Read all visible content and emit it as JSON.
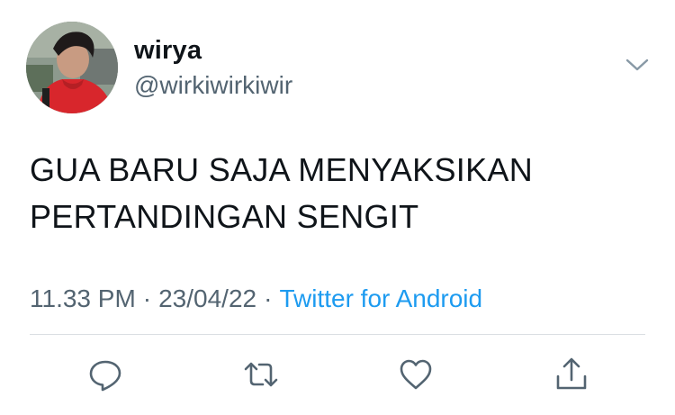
{
  "tweet": {
    "display_name": "wirya",
    "handle": "@wirkiwirkiwir",
    "text_lines": [
      "GUA BARU SAJA MENYAKSIKAN",
      "PERTANDINGAN SENGIT"
    ],
    "time": "11.33 PM",
    "date": "23/04/22",
    "separator": "·",
    "source": "Twitter for Android"
  },
  "icons": {
    "caret": "chevron-down-icon",
    "reply": "reply-icon",
    "retweet": "retweet-icon",
    "like": "heart-icon",
    "share": "share-icon"
  },
  "colors": {
    "text_primary": "#0f1419",
    "text_secondary": "#536471",
    "link": "#1d9bf0",
    "divider": "#dadfe3",
    "icon": "#536471"
  }
}
